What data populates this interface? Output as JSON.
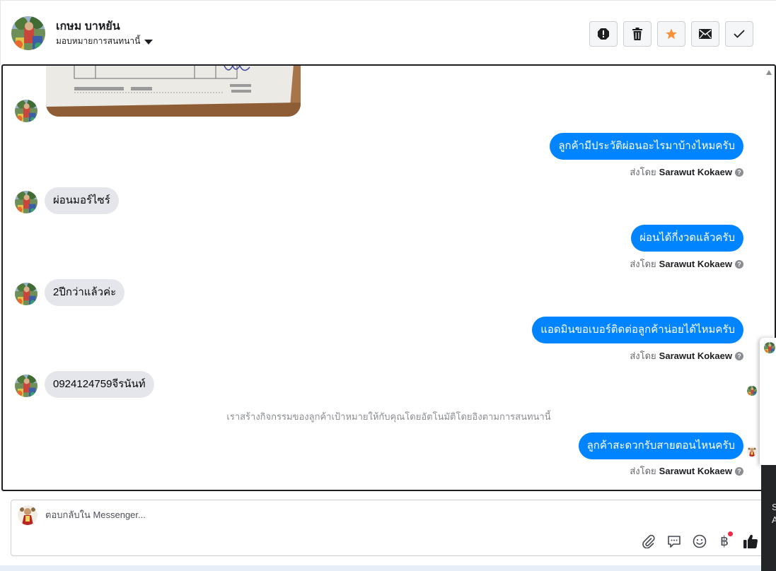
{
  "header": {
    "contact_name": "เกษม บาหยัน",
    "assign_label": "มอบหมายการสนทนานี้"
  },
  "conversation": {
    "messages": [
      {
        "direction": "out",
        "text": "ลูกค้ามีประวัติผ่อนอะไรมาบ้างไหมครับ",
        "sent_by_prefix": "ส่งโดย",
        "sender": "Sarawut Kokaew"
      },
      {
        "direction": "in",
        "text": "ผ่อนมอร์ไซร์"
      },
      {
        "direction": "out",
        "text": "ผ่อนได้กี่งวดแล้วครับ",
        "sent_by_prefix": "ส่งโดย",
        "sender": "Sarawut Kokaew"
      },
      {
        "direction": "in",
        "text": "2ปีกว่าแล้วค่ะ"
      },
      {
        "direction": "out",
        "text": "แอดมินขอเบอร์ติดต่อลูกค้าน่อยได้ไหมครับ",
        "sent_by_prefix": "ส่งโดย",
        "sender": "Sarawut Kokaew"
      },
      {
        "direction": "in",
        "text": "0924124759จีรนันท์"
      },
      {
        "direction": "out",
        "text": "ลูกค้าสะดวกรับสายตอนไหนครับ",
        "sent_by_prefix": "ส่งโดย",
        "sender": "Sarawut Kokaew"
      }
    ],
    "system_note": "เราสร้างกิจกรรมของลูกค้าเป้าหมายให้กับคุณโดยอัตโนมัติโดยอิงตามการสนทนานี้",
    "help_glyph": "?"
  },
  "composer": {
    "placeholder": "ตอบกลับใน Messenger...",
    "baht_symbol": "฿"
  },
  "side_panel": {
    "line1": "S",
    "line2": "A"
  },
  "colors": {
    "outgoing_bubble": "#0084ff",
    "incoming_bubble": "#e4e6eb",
    "star": "#f7923a",
    "notification_dot": "#f02849"
  },
  "icons": [
    "spam-icon",
    "trash-icon",
    "star-icon",
    "envelope-icon",
    "check-icon",
    "attachment-icon",
    "chat-bubble-icon",
    "emoji-icon",
    "baht-icon",
    "thumbs-up-icon",
    "help-icon"
  ]
}
